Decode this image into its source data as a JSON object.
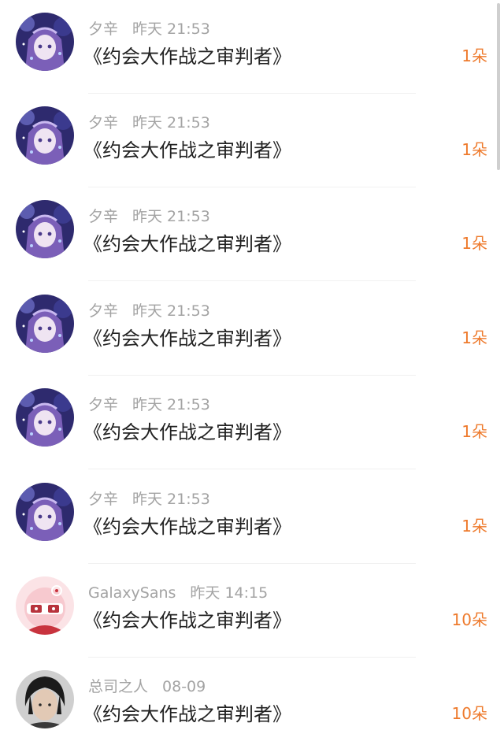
{
  "colors": {
    "accent": "#ee7a2c",
    "meta": "#a3a3a3",
    "title": "#222222"
  },
  "rows": [
    {
      "name": "夕辛",
      "time": "昨天 21:53",
      "title": "《约会大作战之审判者》",
      "count": "1朵",
      "avatar": "anime-purple-avatar"
    },
    {
      "name": "夕辛",
      "time": "昨天 21:53",
      "title": "《约会大作战之审判者》",
      "count": "1朵",
      "avatar": "anime-purple-avatar"
    },
    {
      "name": "夕辛",
      "time": "昨天 21:53",
      "title": "《约会大作战之审判者》",
      "count": "1朵",
      "avatar": "anime-purple-avatar"
    },
    {
      "name": "夕辛",
      "time": "昨天 21:53",
      "title": "《约会大作战之审判者》",
      "count": "1朵",
      "avatar": "anime-purple-avatar"
    },
    {
      "name": "夕辛",
      "time": "昨天 21:53",
      "title": "《约会大作战之审判者》",
      "count": "1朵",
      "avatar": "anime-purple-avatar"
    },
    {
      "name": "夕辛",
      "time": "昨天 21:53",
      "title": "《约会大作战之审判者》",
      "count": "1朵",
      "avatar": "anime-purple-avatar"
    },
    {
      "name": "GalaxySans",
      "time": "昨天 14:15",
      "title": "《约会大作战之审判者》",
      "count": "10朵",
      "avatar": "cartoon-face-avatar"
    },
    {
      "name": "总司之人",
      "time": "08-09",
      "title": "《约会大作战之审判者》",
      "count": "10朵",
      "avatar": "person-photo-avatar"
    }
  ]
}
